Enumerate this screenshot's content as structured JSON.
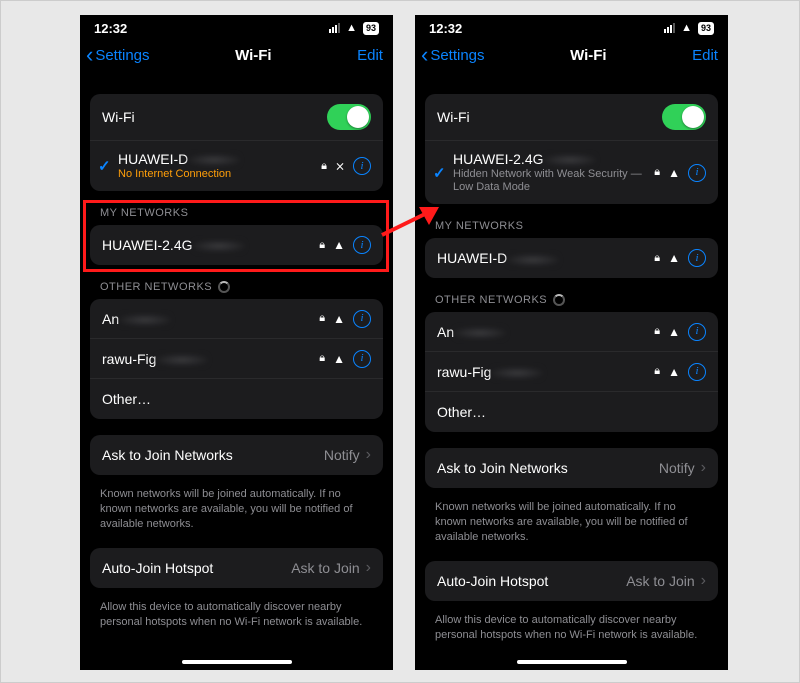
{
  "status": {
    "time": "12:32",
    "battery": "93"
  },
  "nav": {
    "back": "Settings",
    "title": "Wi-Fi",
    "edit": "Edit"
  },
  "wifi_label": "Wi-Fi",
  "left": {
    "connected": {
      "ssid": "HUAWEI-D",
      "sub": "No Internet Connection"
    },
    "my_hdr": "MY NETWORKS",
    "my": [
      {
        "ssid": "HUAWEI-2.4G"
      }
    ],
    "other_hdr": "OTHER NETWORKS",
    "other": [
      {
        "ssid": "An"
      },
      {
        "ssid": "rawu-Fig"
      },
      {
        "ssid": "Other…"
      }
    ]
  },
  "right": {
    "connected": {
      "ssid": "HUAWEI-2.4G",
      "sub": "Hidden Network with Weak Security — Low Data Mode"
    },
    "my_hdr": "MY NETWORKS",
    "my": [
      {
        "ssid": "HUAWEI-D"
      }
    ],
    "other_hdr": "OTHER NETWORKS",
    "other": [
      {
        "ssid": "An"
      },
      {
        "ssid": "rawu-Fig"
      },
      {
        "ssid": "Other…"
      }
    ]
  },
  "ask": {
    "label": "Ask to Join Networks",
    "value": "Notify",
    "foot": "Known networks will be joined automatically. If no known networks are available, you will be notified of available networks."
  },
  "auto": {
    "label": "Auto-Join Hotspot",
    "value": "Ask to Join",
    "foot": "Allow this device to automatically discover nearby personal hotspots when no Wi-Fi network is available."
  }
}
